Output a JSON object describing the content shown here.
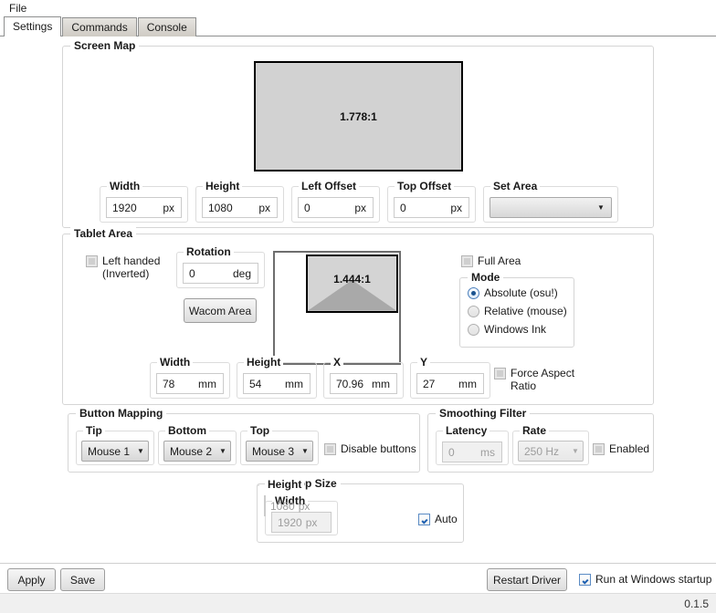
{
  "window": {
    "menu": [
      {
        "label": "File"
      }
    ],
    "tabs": [
      {
        "label": "Settings",
        "active": true
      },
      {
        "label": "Commands",
        "active": false
      },
      {
        "label": "Console",
        "active": false
      }
    ]
  },
  "screen_map": {
    "title": "Screen Map",
    "preview_ratio": "1.778:1",
    "width": {
      "label": "Width",
      "value": "1920",
      "unit": "px"
    },
    "height": {
      "label": "Height",
      "value": "1080",
      "unit": "px"
    },
    "left_offset": {
      "label": "Left Offset",
      "value": "0",
      "unit": "px"
    },
    "top_offset": {
      "label": "Top Offset",
      "value": "0",
      "unit": "px"
    },
    "set_area": {
      "label": "Set Area",
      "value": "",
      "arrow_icon": "chevron-down-icon"
    }
  },
  "tablet_area": {
    "title": "Tablet Area",
    "left_handed": {
      "label": "Left handed (Inverted)",
      "checked": false
    },
    "rotation": {
      "label": "Rotation",
      "value": "0",
      "unit": "deg"
    },
    "wacom_area_button": "Wacom Area",
    "preview_ratio": "1.444:1",
    "full_area": {
      "label": "Full Area",
      "checked": false
    },
    "mode": {
      "label": "Mode",
      "options": [
        {
          "label": "Absolute (osu!)",
          "selected": true
        },
        {
          "label": "Relative (mouse)",
          "selected": false
        },
        {
          "label": "Windows Ink",
          "selected": false
        }
      ]
    },
    "width": {
      "label": "Width",
      "value": "78",
      "unit": "mm"
    },
    "height": {
      "label": "Height",
      "value": "54",
      "unit": "mm"
    },
    "x": {
      "label": "X",
      "value": "70.96",
      "unit": "mm"
    },
    "y": {
      "label": "Y",
      "value": "27",
      "unit": "mm"
    },
    "force_aspect_ratio": {
      "label": "Force Aspect Ratio",
      "checked": false
    }
  },
  "button_mapping": {
    "title": "Button Mapping",
    "tip": {
      "label": "Tip",
      "value": "Mouse 1"
    },
    "bottom": {
      "label": "Bottom",
      "value": "Mouse 2"
    },
    "top": {
      "label": "Top",
      "value": "Mouse 3"
    },
    "disable_buttons": {
      "label": "Disable buttons",
      "checked": false
    }
  },
  "smoothing_filter": {
    "title": "Smoothing Filter",
    "latency": {
      "label": "Latency",
      "value": "0",
      "unit": "ms"
    },
    "rate": {
      "label": "Rate",
      "value": "250 Hz"
    },
    "enabled": {
      "label": "Enabled",
      "checked": false
    }
  },
  "desktop_size": {
    "title": "Desktop Size",
    "width": {
      "label": "Width",
      "value": "1920",
      "unit": "px"
    },
    "height": {
      "label": "Height",
      "value": "1080",
      "unit": "px"
    },
    "auto": {
      "label": "Auto",
      "checked": true
    }
  },
  "footer": {
    "apply": "Apply",
    "save": "Save",
    "restart_driver": "Restart Driver",
    "run_at_startup": {
      "label": "Run at Windows startup",
      "checked": true
    },
    "version": "0.1.5"
  }
}
